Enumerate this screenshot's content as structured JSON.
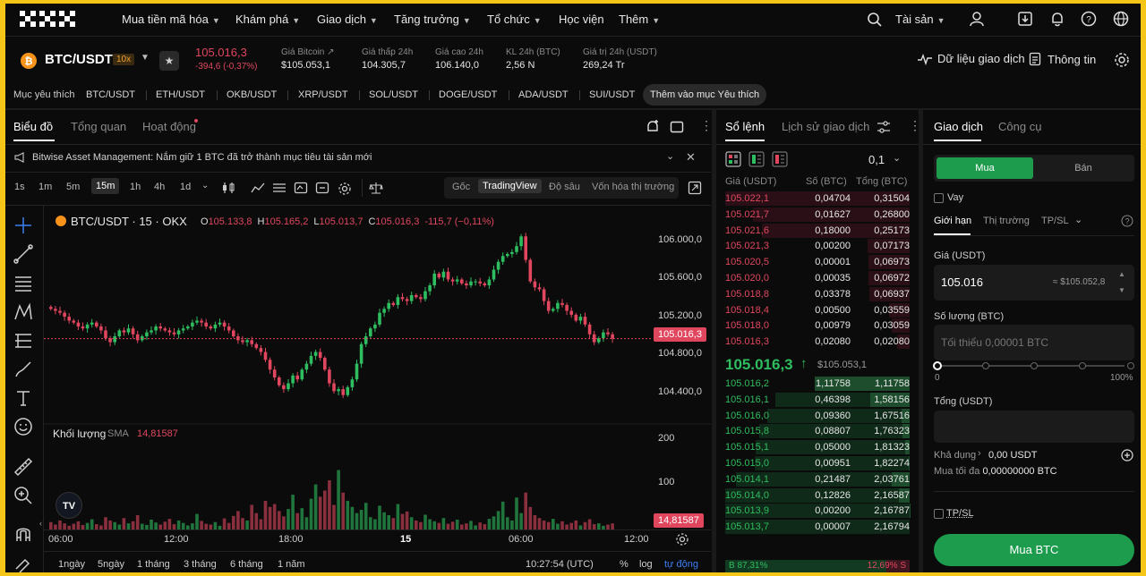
{
  "nav": {
    "logo": "OKX",
    "items": [
      "Mua tiền mã hóa",
      "Khám phá",
      "Giao dịch",
      "Tăng trưởng",
      "Tổ chức",
      "Học viện",
      "Thêm"
    ],
    "assets": "Tài sản"
  },
  "ticker": {
    "pair": "BTC/USDT",
    "leverage": "10x",
    "price": "105.016,3",
    "change": "-394,6 (-0,37%)",
    "stats": [
      {
        "label": "Giá Bitcoin",
        "value": "$105.053,1"
      },
      {
        "label": "Giá thấp 24h",
        "value": "104.305,7"
      },
      {
        "label": "Giá cao 24h",
        "value": "106.140,0"
      },
      {
        "label": "KL 24h (BTC)",
        "value": "2,56 N"
      },
      {
        "label": "Giá trị 24h (USDT)",
        "value": "269,24 Tr"
      }
    ],
    "trading_data": "Dữ liệu giao dịch",
    "info": "Thông tin"
  },
  "favorites": {
    "label": "Mục yêu thích",
    "items": [
      "BTC/USDT",
      "ETH/USDT",
      "OKB/USDT",
      "XRP/USDT",
      "SOL/USDT",
      "DOGE/USDT",
      "ADA/USDT",
      "SUI/USDT"
    ],
    "add": "Thêm vào mục Yêu thích"
  },
  "chart_panel": {
    "tabs": [
      "Biểu đồ",
      "Tổng quan",
      "Hoạt động"
    ],
    "news": "Bitwise Asset Management: Nắm giữ 1 BTC đã trở thành mục tiêu tài sản mới",
    "intervals": [
      "1s",
      "1m",
      "5m",
      "15m",
      "1h",
      "4h",
      "1d"
    ],
    "active_interval": "15m",
    "views": [
      "Gốc",
      "TradingView",
      "Độ sâu",
      "Vốn hóa thị trường"
    ],
    "active_view": "TradingView",
    "legend_symbol": "BTC/USDT · 15 · OKX",
    "ohlc": {
      "o": "105.133,8",
      "h": "105.165,2",
      "l": "105.013,7",
      "c": "105.016,3",
      "chg": "-115,7 (−0,11%)"
    },
    "volume_label": "Khối lượng",
    "volume_sma": "SMA",
    "volume_value": "14,81587",
    "price_axis": [
      "106.000,0",
      "105.600,0",
      "105.200,0",
      "104.800,0",
      "104.400,0"
    ],
    "last_price": "105.016,3",
    "volume_axis": [
      "200",
      "100"
    ],
    "last_volume": "14,81587",
    "time_axis": [
      "06:00",
      "12:00",
      "18:00",
      "15",
      "06:00",
      "12:00"
    ],
    "ranges": [
      "1ngày",
      "5ngày",
      "1 tháng",
      "3 tháng",
      "6 tháng",
      "1 năm"
    ],
    "clock": "10:27:54 (UTC)",
    "pct": "%",
    "log": "log",
    "auto": "tự động"
  },
  "chart_data": {
    "type": "candlestick",
    "ylim": [
      104200,
      106300
    ],
    "volume_ylim": [
      0,
      240
    ],
    "closes": [
      105320,
      105300,
      105280,
      105240,
      105200,
      105180,
      105140,
      105120,
      105160,
      105180,
      105140,
      105100,
      105020,
      104980,
      105040,
      105100,
      105080,
      105120,
      105060,
      105000,
      105040,
      105080,
      105100,
      105140,
      105120,
      105100,
      105080,
      105060,
      105100,
      105120,
      105140,
      105180,
      105200,
      105180,
      105140,
      105120,
      105160,
      105180,
      105140,
      105100,
      105040,
      105000,
      104980,
      105000,
      104960,
      104920,
      104880,
      104800,
      104700,
      104620,
      104540,
      104500,
      104560,
      104640,
      104600,
      104700,
      104760,
      104840,
      104880,
      104820,
      104700,
      104560,
      104480,
      104500,
      104440,
      104520,
      104600,
      104760,
      104960,
      105040,
      105120,
      105160,
      105280,
      105320,
      105380,
      105360,
      105440,
      105420,
      105400,
      105460,
      105440,
      105420,
      105500,
      105560,
      105680,
      105640,
      105700,
      105620,
      105600,
      105620,
      105580,
      105560,
      105600,
      105600,
      105580,
      105560,
      105620,
      105720,
      105800,
      105860,
      105880,
      105900,
      105960,
      106060,
      105820,
      105600,
      105540,
      105520,
      105400,
      105300,
      105320,
      105380,
      105360,
      105300,
      105260,
      105200,
      105240,
      105160,
      105060,
      104980,
      105020,
      105080,
      105060,
      105016
    ],
    "volumes": [
      18,
      12,
      22,
      15,
      9,
      14,
      20,
      11,
      16,
      25,
      13,
      10,
      30,
      22,
      18,
      12,
      28,
      15,
      20,
      35,
      14,
      11,
      24,
      17,
      12,
      19,
      26,
      13,
      22,
      16,
      10,
      15,
      38,
      21,
      14,
      12,
      18,
      9,
      27,
      16,
      33,
      45,
      28,
      22,
      60,
      40,
      25,
      70,
      55,
      62,
      45,
      32,
      50,
      85,
      40,
      52,
      30,
      75,
      110,
      80,
      95,
      120,
      60,
      145,
      90,
      70,
      55,
      40,
      48,
      65,
      30,
      25,
      58,
      42,
      35,
      28,
      62,
      38,
      44,
      30,
      22,
      18,
      36,
      25,
      20,
      16,
      28,
      14,
      19,
      24,
      12,
      15,
      21,
      10,
      17,
      13,
      26,
      32,
      45,
      68,
      30,
      22,
      78,
      40,
      90,
      55,
      35,
      28,
      22,
      18,
      26,
      14,
      20,
      12,
      16,
      22,
      10,
      18,
      25,
      13,
      15,
      9,
      12,
      15
    ]
  },
  "orderbook": {
    "tabs": [
      "Sổ lệnh",
      "Lịch sử giao dịch"
    ],
    "step": "0,1",
    "headers": [
      "Giá (USDT)",
      "Số (BTC)",
      "Tổng (BTC)"
    ],
    "asks": [
      [
        "105.022,1",
        "0,04704",
        "0,31504",
        0.31504
      ],
      [
        "105.021,7",
        "0,01627",
        "0,26800",
        0.268
      ],
      [
        "105.021,6",
        "0,18000",
        "0,25173",
        0.25173
      ],
      [
        "105.021,3",
        "0,00200",
        "0,07173",
        0.07173
      ],
      [
        "105.020,5",
        "0,00001",
        "0,06973",
        0.06973
      ],
      [
        "105.020,0",
        "0,00035",
        "0,06972",
        0.06972
      ],
      [
        "105.018,8",
        "0,03378",
        "0,06937",
        0.06937
      ],
      [
        "105.018,4",
        "0,00500",
        "0,03559",
        0.03559
      ],
      [
        "105.018,0",
        "0,00979",
        "0,03059",
        0.03059
      ],
      [
        "105.016,3",
        "0,02080",
        "0,02080",
        0.0208
      ]
    ],
    "mid_price": "105.016,3",
    "mid_usd": "$105.053,1",
    "bids": [
      [
        "105.016,2",
        "1,11758",
        "1,11758",
        1.11758,
        1.11758
      ],
      [
        "105.016,1",
        "0,46398",
        "1,58156",
        1.58156,
        0.46398
      ],
      [
        "105.016,0",
        "0,09360",
        "1,67516",
        1.67516,
        0.0936
      ],
      [
        "105.015,8",
        "0,08807",
        "1,76323",
        1.76323,
        0.08807
      ],
      [
        "105.015,1",
        "0,05000",
        "1,81323",
        1.81323,
        0.05
      ],
      [
        "105.015,0",
        "0,00951",
        "1,82274",
        1.82274,
        0.00951
      ],
      [
        "105.014,1",
        "0,21487",
        "2,03761",
        2.03761,
        0.21487
      ],
      [
        "105.014,0",
        "0,12826",
        "2,16587",
        2.16587,
        0.12826
      ],
      [
        "105.013,9",
        "0,00200",
        "2,16787",
        2.16787,
        0.002
      ],
      [
        "105.013,7",
        "0,00007",
        "2,16794",
        2.16794,
        7e-05
      ]
    ],
    "buy_pct": "B 87,31%",
    "sell_pct": "12,69% S"
  },
  "trade": {
    "tabs": [
      "Giao dịch",
      "Công cụ"
    ],
    "buy": "Mua",
    "sell": "Bán",
    "borrow": "Vay",
    "order_types": [
      "Giới hạn",
      "Thị trường",
      "TP/SL"
    ],
    "price_label": "Giá (USDT)",
    "price_value": "105.016",
    "price_usd": "≈ $105.052,8",
    "qty_label": "Số lượng (BTC)",
    "qty_placeholder": "Tối thiểu 0,00001 BTC",
    "slider_min": "0",
    "slider_max": "100%",
    "total_label": "Tổng (USDT)",
    "available_label": "Khả dụng",
    "available_value": "0,00 USDT",
    "max_buy_label": "Mua tối đa",
    "max_buy_value": "0,00000000 BTC",
    "tpsl": "TP/SL",
    "submit": "Mua BTC"
  },
  "colors": {
    "up": "#2ebd5f",
    "down": "#e0475f",
    "accent": "#1e9c4e"
  }
}
